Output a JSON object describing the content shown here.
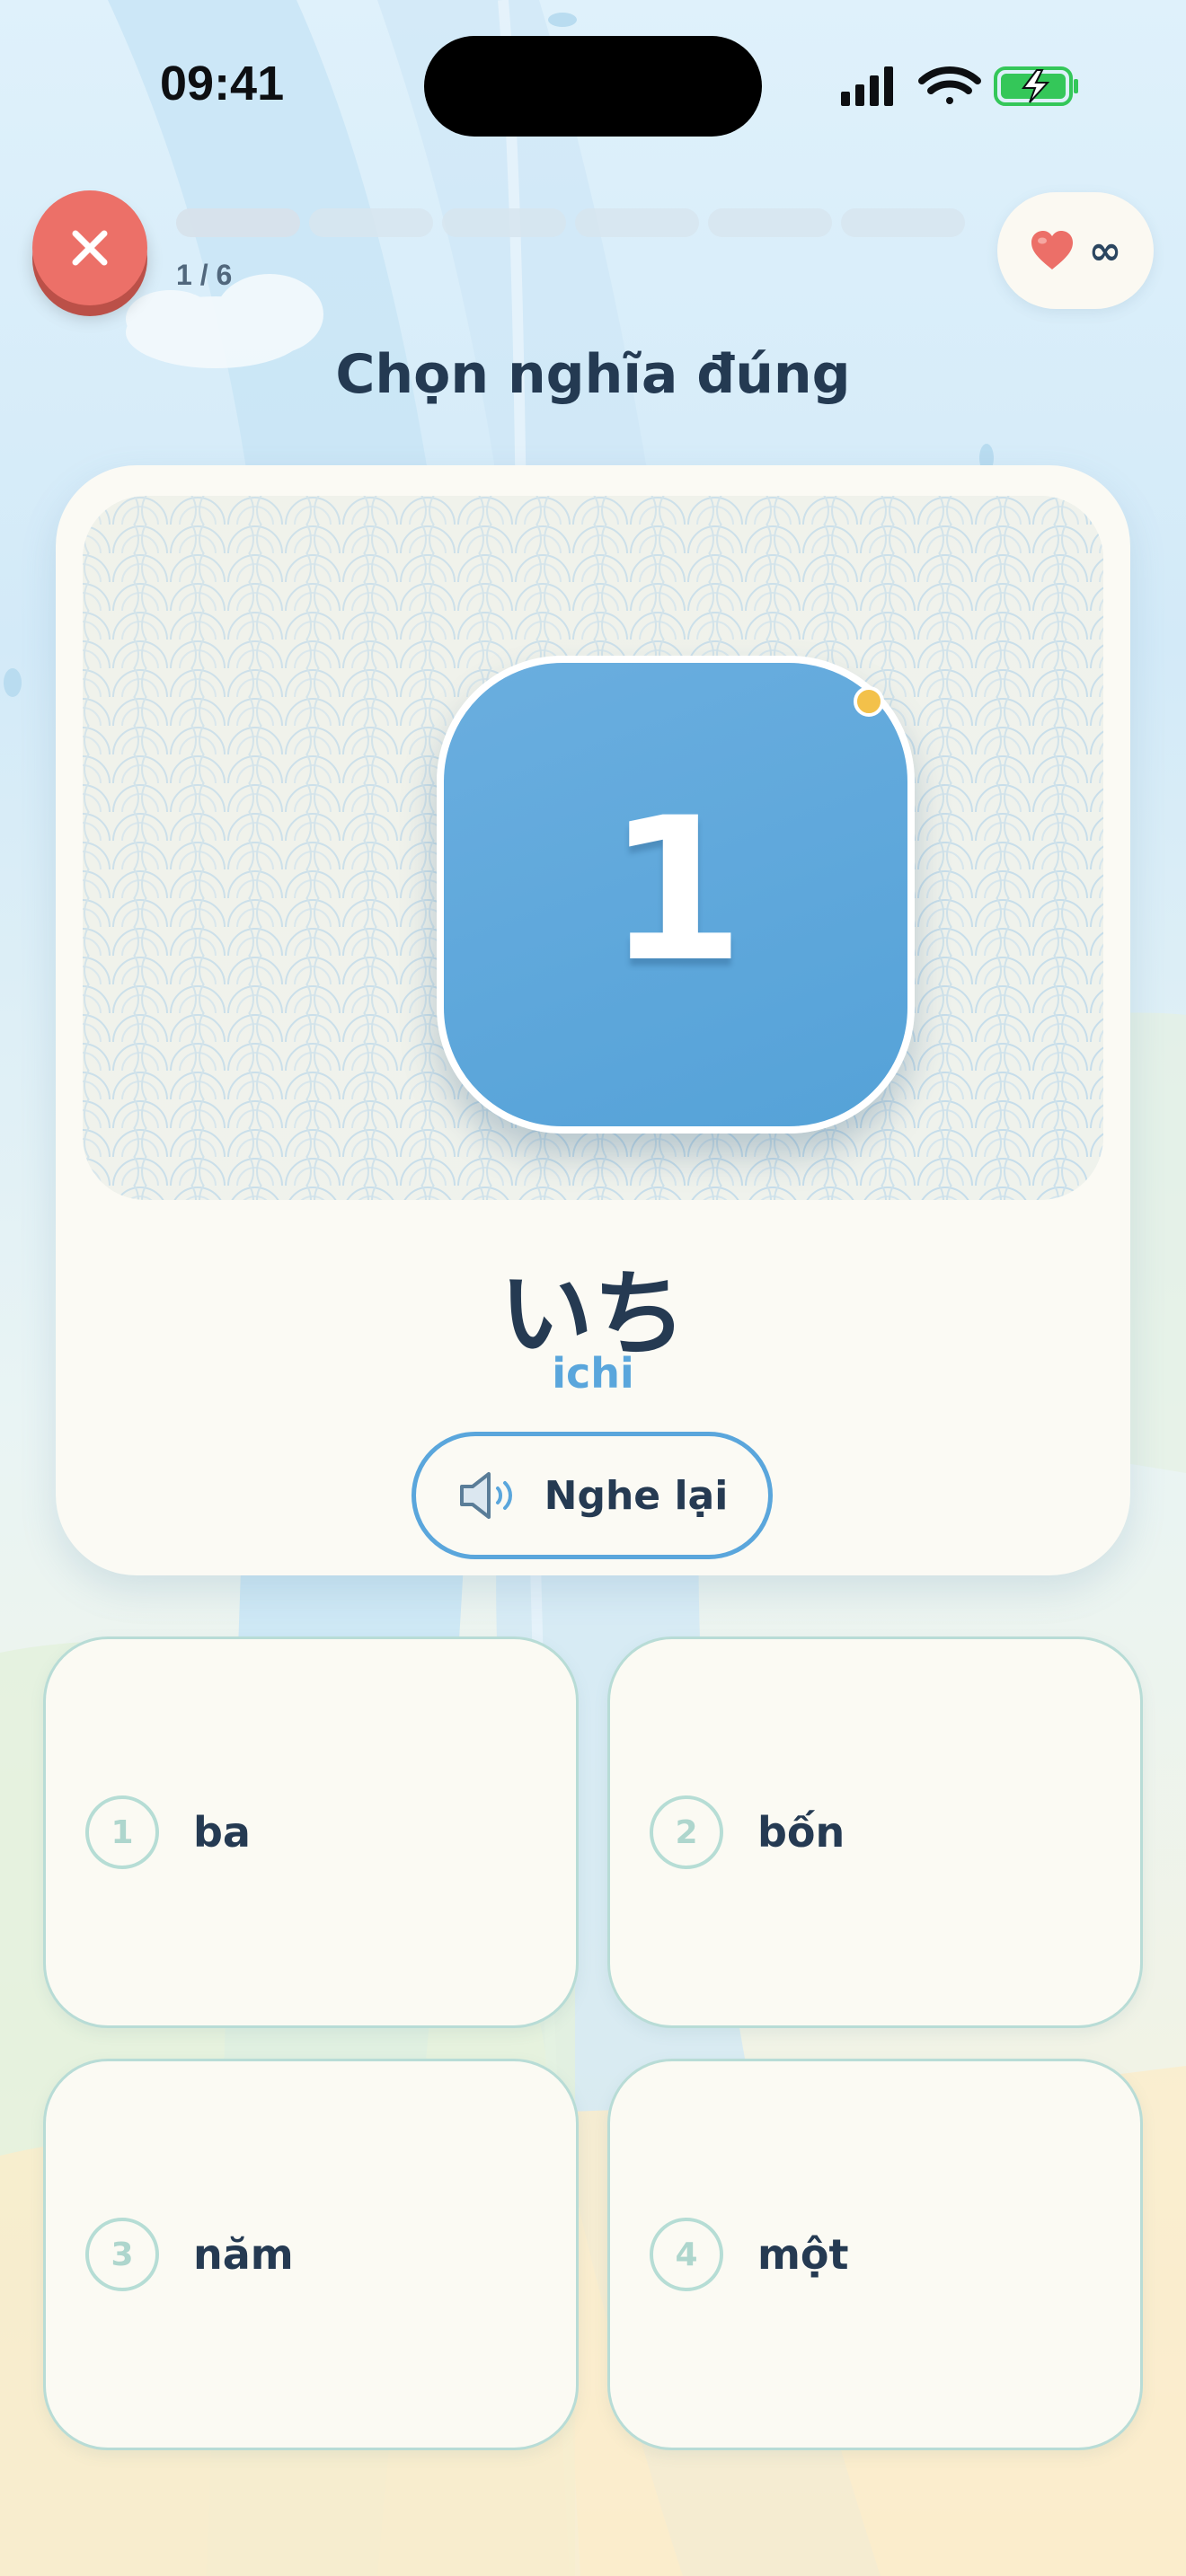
{
  "status_bar": {
    "time": "09:41"
  },
  "header": {
    "close_icon": "close-icon",
    "progress_count": "1 / 6",
    "progress_segments": 6,
    "progress_completed": 0,
    "lives_icon": "heart-icon",
    "lives_value": "∞"
  },
  "title": "Chọn nghĩa đúng",
  "card": {
    "number": "1",
    "word": "いち",
    "romaji": "ichi",
    "listen_icon": "speaker-icon",
    "listen_label": "Nghe lại"
  },
  "options": [
    {
      "number": "1",
      "label": "ba"
    },
    {
      "number": "2",
      "label": "bốn"
    },
    {
      "number": "3",
      "label": "năm"
    },
    {
      "number": "4",
      "label": "một"
    }
  ],
  "colors": {
    "accent": "#5aa6dc",
    "close": "#ec7068",
    "heart": "#ec6f68",
    "option_border": "#b8dcd6"
  }
}
